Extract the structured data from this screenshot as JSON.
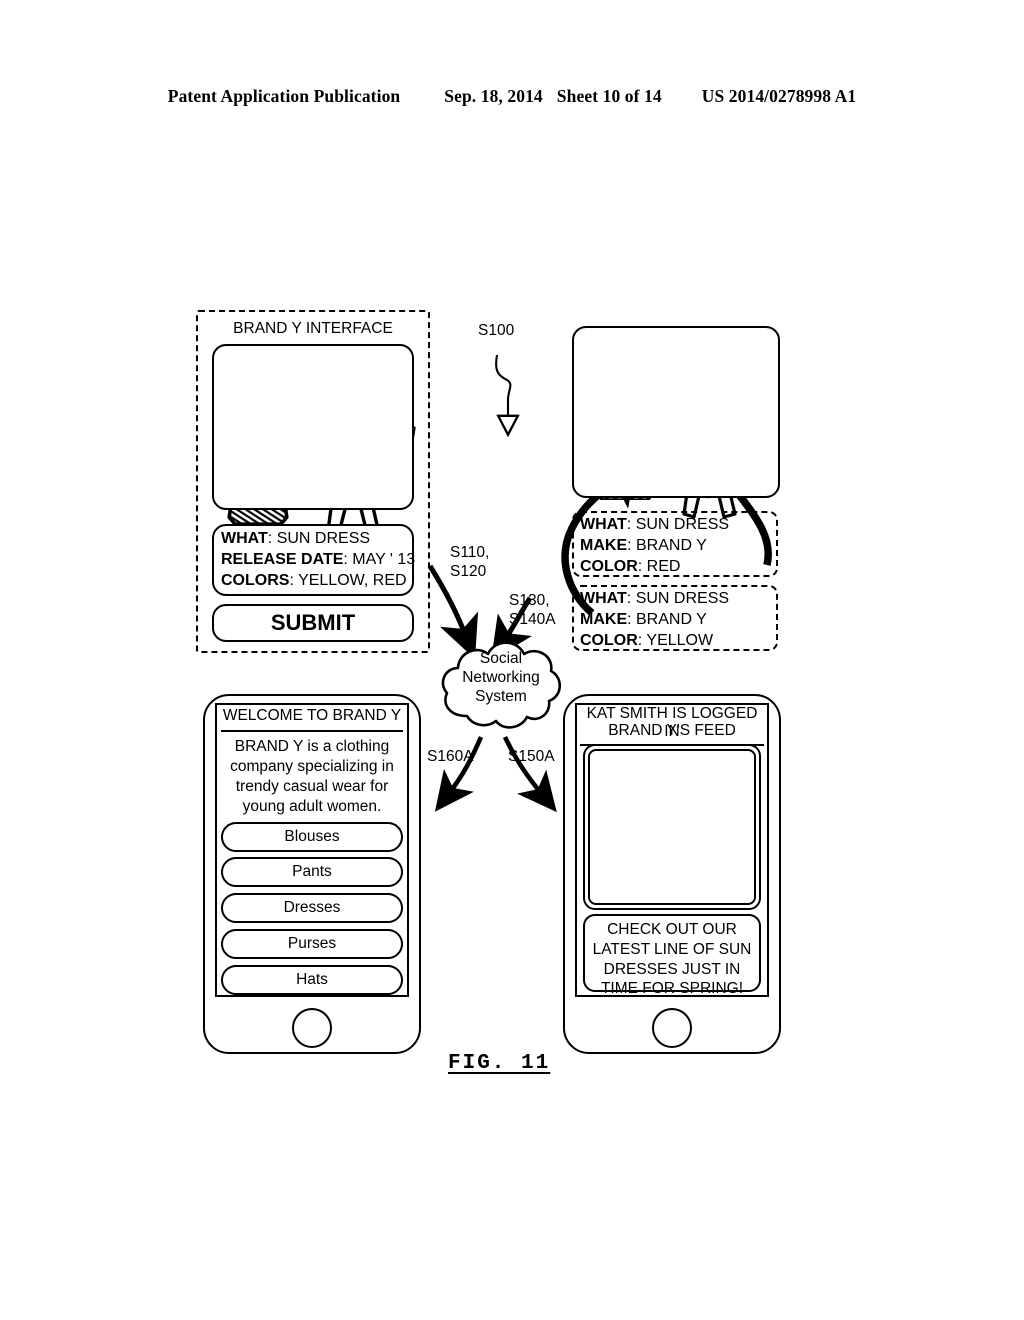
{
  "header": {
    "publication": "Patent Application Publication",
    "date": "Sep. 18, 2014",
    "sheet": "Sheet 10 of 14",
    "number": "US 2014/0278998 A1"
  },
  "figure": {
    "caption": "FIG. 11"
  },
  "brand_interface": {
    "title": "BRAND Y INTERFACE",
    "form": {
      "rows": [
        {
          "key": "WHAT",
          "value": "SUN DRESS"
        },
        {
          "key": "RELEASE DATE",
          "value": "MAY ' 13"
        },
        {
          "key": "COLORS",
          "value": "YELLOW, RED"
        }
      ]
    },
    "submit_label": "SUBMIT",
    "preview_icons": [
      "striped-dress-icon",
      "hatched-dress-icon",
      "woman-stick-figure-icon"
    ]
  },
  "steps": {
    "s100": "S100",
    "s110_s120": "S110,\nS120",
    "s110_line1": "S110,",
    "s110_line2": "S120",
    "s130_line1": "S130,",
    "s130_line2": "S140A",
    "s150a": "S150A",
    "s160a": "S160A"
  },
  "cloud": {
    "line1": "Social",
    "line2": "Networking",
    "line3": "System"
  },
  "object_cards": [
    {
      "rows": [
        {
          "key": "WHAT",
          "value": "SUN DRESS"
        },
        {
          "key": "MAKE",
          "value": "BRAND Y"
        },
        {
          "key": "COLOR",
          "value": "RED"
        }
      ]
    },
    {
      "rows": [
        {
          "key": "WHAT",
          "value": "SUN DRESS"
        },
        {
          "key": "MAKE",
          "value": "BRAND Y"
        },
        {
          "key": "COLOR",
          "value": "YELLOW"
        }
      ]
    }
  ],
  "tagged_panel": {
    "icons": [
      "striped-dress-icon",
      "hatched-dress-icon",
      "woman-stick-figure-icon"
    ]
  },
  "brand_phone": {
    "title": "WELCOME TO BRAND Y",
    "description": "BRAND Y is a clothing company specializing in trendy casual wear for young adult women.",
    "menu": [
      "Blouses",
      "Pants",
      "Dresses",
      "Purses",
      "Hats"
    ]
  },
  "user_phone": {
    "title": "KAT SMITH IS LOGGED IN",
    "subtitle": "BRAND Y'S FEED",
    "post_text": "CHECK OUT OUR LATEST LINE OF SUN DRESSES JUST IN TIME FOR SPRING!",
    "icons": [
      "striped-dress-icon",
      "hatched-dress-icon",
      "woman-stick-figure-icon"
    ]
  },
  "colors": {
    "ink": "#000000",
    "paper": "#ffffff"
  }
}
